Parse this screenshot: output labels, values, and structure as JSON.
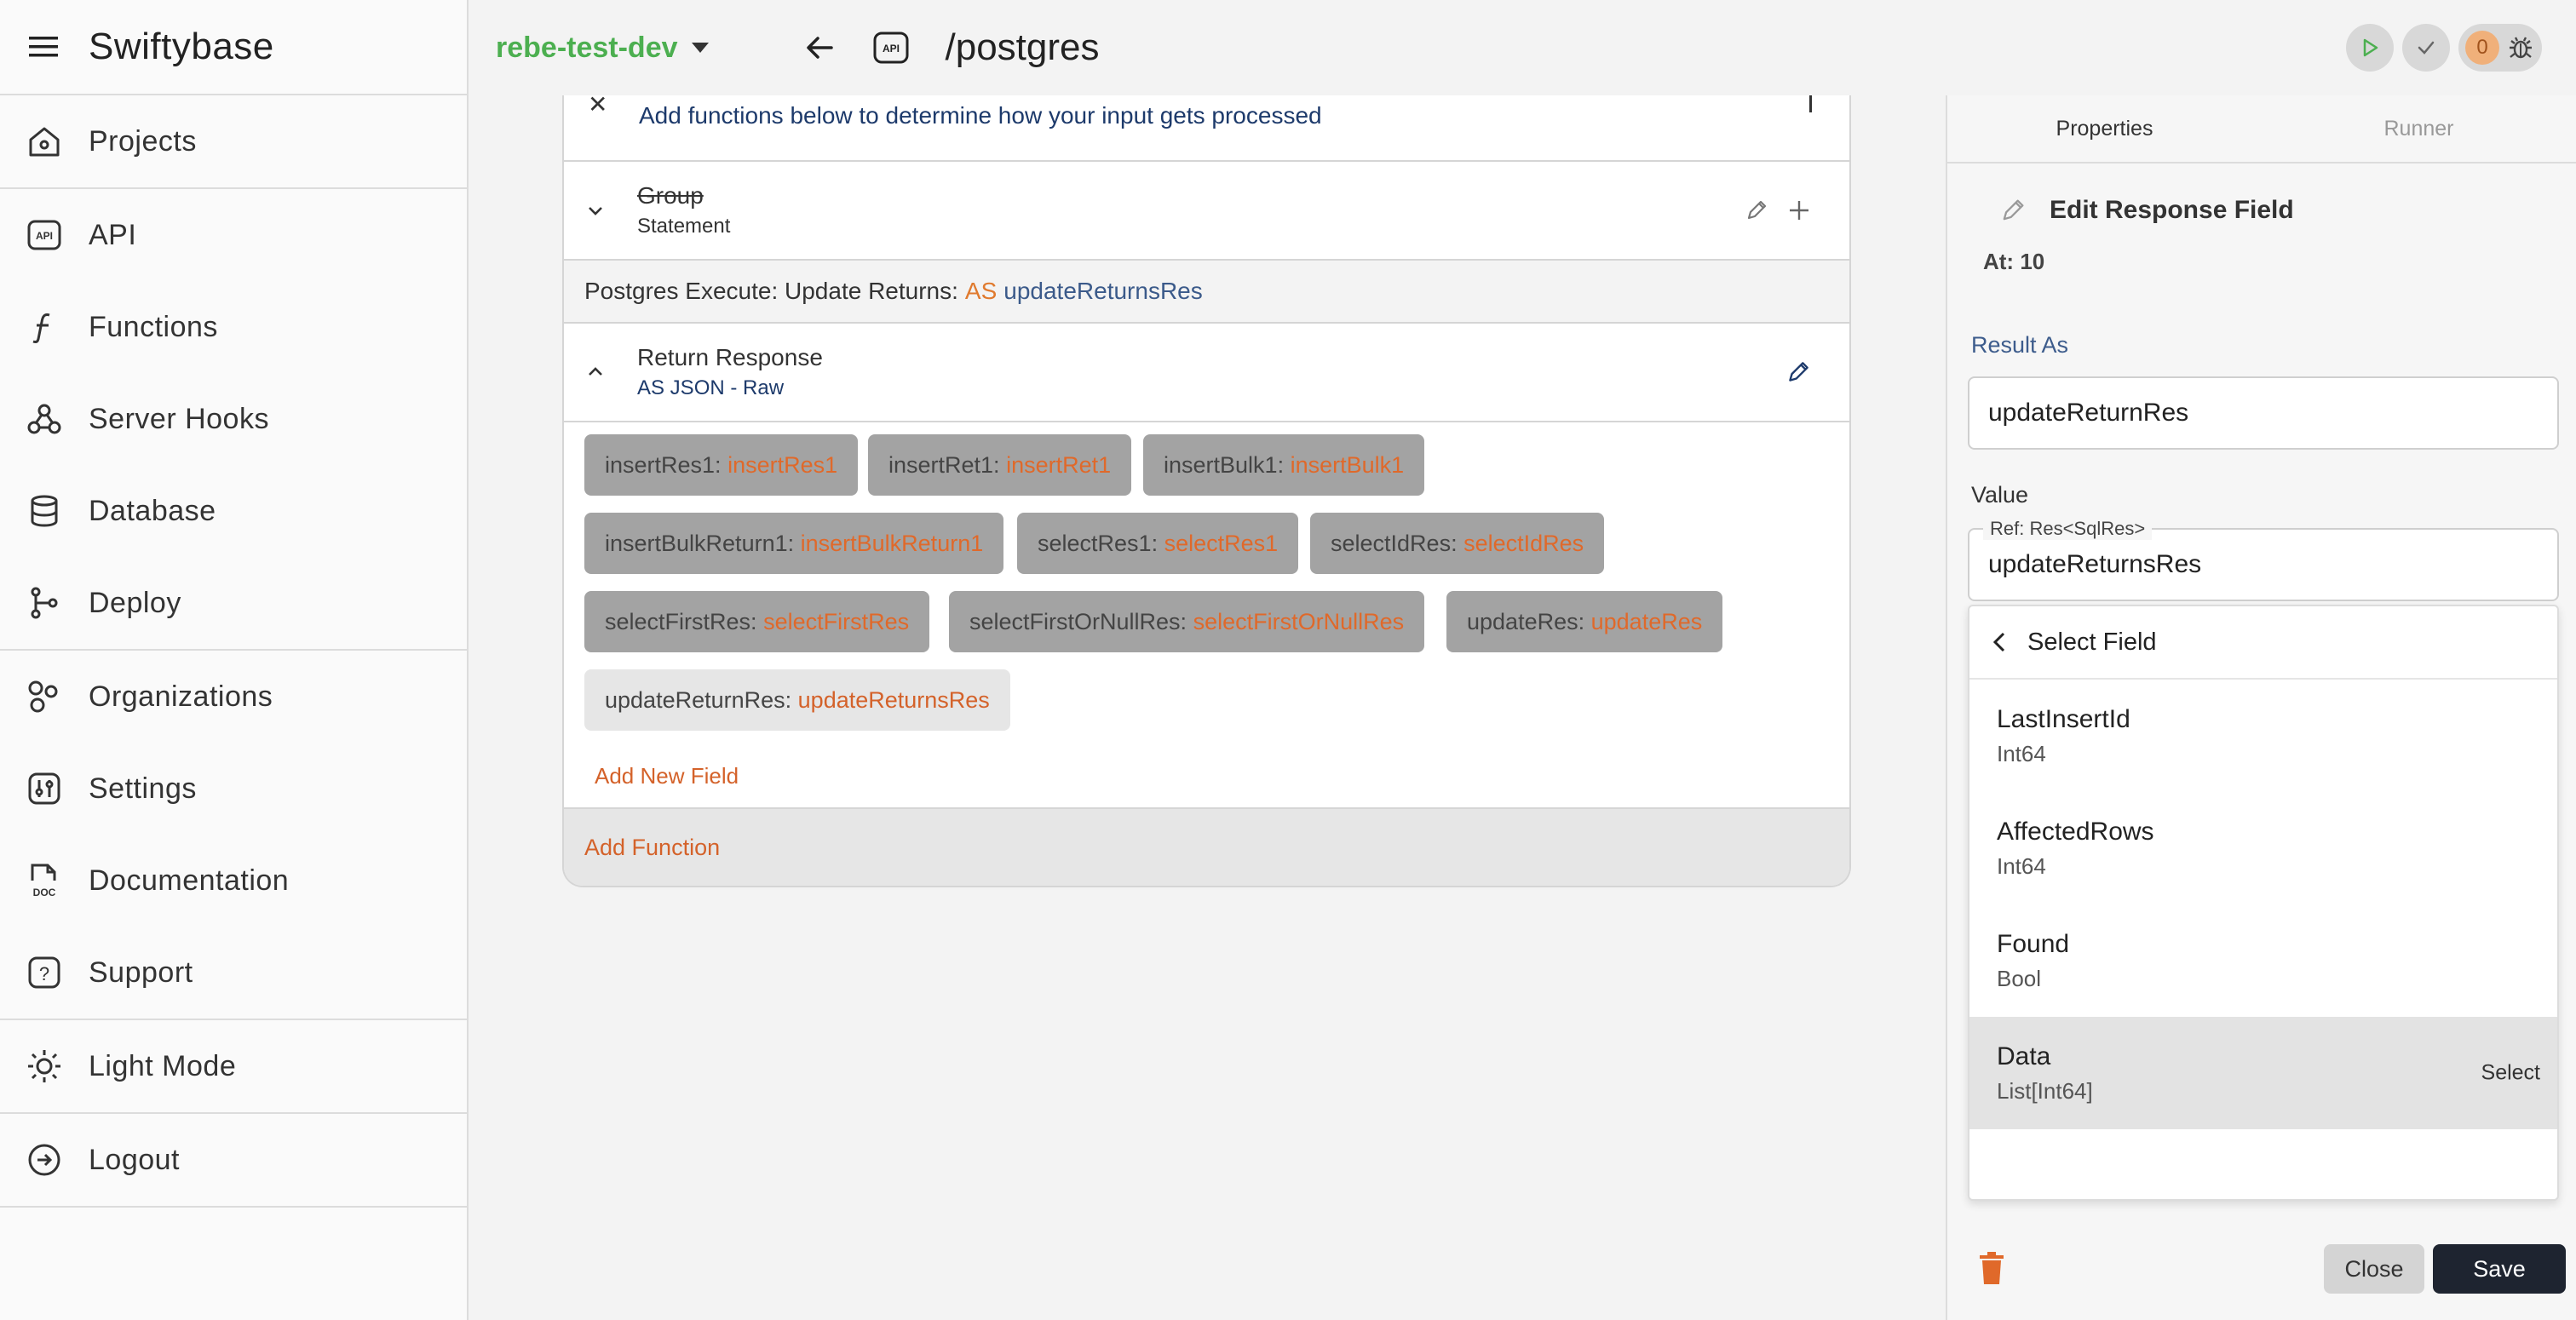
{
  "sidebar": {
    "brand": "Swiftybase",
    "items": [
      {
        "label": "Projects",
        "icon": "home-icon"
      },
      {
        "label": "API",
        "icon": "api-icon"
      },
      {
        "label": "Functions",
        "icon": "function-icon"
      },
      {
        "label": "Server Hooks",
        "icon": "webhook-icon"
      },
      {
        "label": "Database",
        "icon": "database-icon"
      },
      {
        "label": "Deploy",
        "icon": "git-branch-icon"
      },
      {
        "label": "Organizations",
        "icon": "organizations-icon"
      },
      {
        "label": "Settings",
        "icon": "settings-icon"
      },
      {
        "label": "Documentation",
        "icon": "doc-icon"
      },
      {
        "label": "Support",
        "icon": "help-icon"
      },
      {
        "label": "Light Mode",
        "icon": "sun-icon"
      },
      {
        "label": "Logout",
        "icon": "logout-icon"
      }
    ]
  },
  "topbar": {
    "project": "rebe-test-dev",
    "route": "/postgres",
    "debug_count": "0"
  },
  "editor": {
    "intro_text": "Add functions below to determine how your input gets processed",
    "group": {
      "title": "Group",
      "subtitle": "Statement"
    },
    "postgres_row": {
      "label": "Postgres Execute: Update Returns:",
      "as": "AS",
      "ref": "updateReturnsRes"
    },
    "return_response": {
      "title": "Return Response",
      "subtitle": "AS JSON - Raw"
    },
    "chips": [
      {
        "key": "insertRes1:",
        "value": "insertRes1"
      },
      {
        "key": "insertRet1:",
        "value": "insertRet1"
      },
      {
        "key": "insertBulk1:",
        "value": "insertBulk1"
      },
      {
        "key": "insertBulkReturn1:",
        "value": "insertBulkReturn1"
      },
      {
        "key": "selectRes1:",
        "value": "selectRes1"
      },
      {
        "key": "selectIdRes:",
        "value": "selectIdRes"
      },
      {
        "key": "selectFirstRes:",
        "value": "selectFirstRes"
      },
      {
        "key": "selectFirstOrNullRes:",
        "value": "selectFirstOrNullRes"
      },
      {
        "key": "updateRes:",
        "value": "updateRes"
      },
      {
        "key": "updateReturnRes:",
        "value": "updateReturnsRes"
      }
    ],
    "add_field": "Add New Field",
    "add_function": "Add Function"
  },
  "right_panel": {
    "tabs": [
      "Properties",
      "Runner"
    ],
    "title": "Edit Response Field",
    "at": "At: 10",
    "result_as_label": "Result As",
    "result_as_value": "updateReturnRes",
    "value_label": "Value",
    "value_legend": "Ref: Res<SqlRes>",
    "value_value": "updateReturnsRes",
    "dropdown": {
      "header": "Select Field",
      "items": [
        {
          "name": "LastInsertId",
          "type": "Int64"
        },
        {
          "name": "AffectedRows",
          "type": "Int64"
        },
        {
          "name": "Found",
          "type": "Bool"
        },
        {
          "name": "Data",
          "type": "List[Int64]",
          "action": "Select"
        }
      ]
    },
    "close_label": "Close",
    "save_label": "Save"
  },
  "colors": {
    "accent_orange": "#e0692a",
    "project_green": "#4caf50",
    "label_blue": "#3d5c8c",
    "save_dark": "#1e2430"
  }
}
